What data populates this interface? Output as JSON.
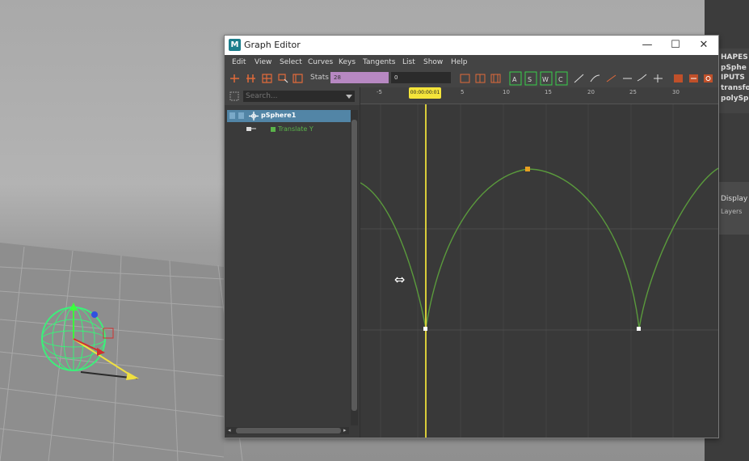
{
  "window": {
    "title": "Graph Editor",
    "logo": "M",
    "minimize": "—",
    "maximize": "☐",
    "close": "✕"
  },
  "menu": [
    "Edit",
    "View",
    "Select",
    "Curves",
    "Keys",
    "Tangents",
    "List",
    "Show",
    "Help"
  ],
  "toolbar": {
    "stats_label": "Stats",
    "stats_value": "28",
    "number_value": "0"
  },
  "outliner": {
    "search_placeholder": "Search...",
    "object_name": "pSphere1",
    "channel_name": "Translate Y"
  },
  "graph": {
    "current_time": "00:00:00:01",
    "ruler_ticks": [
      "-5",
      "0",
      "5",
      "10",
      "15",
      "20",
      "25",
      "30"
    ],
    "curve_color": "#5a9a3c",
    "selected_key_color": "#e8a020"
  },
  "channel_box": {
    "shapes": "HAPES",
    "shape_node": "pSphe",
    "inputs": "IPUTS",
    "transform": "transfo",
    "poly": "polySp",
    "display": "Display",
    "layers": "Layers"
  }
}
